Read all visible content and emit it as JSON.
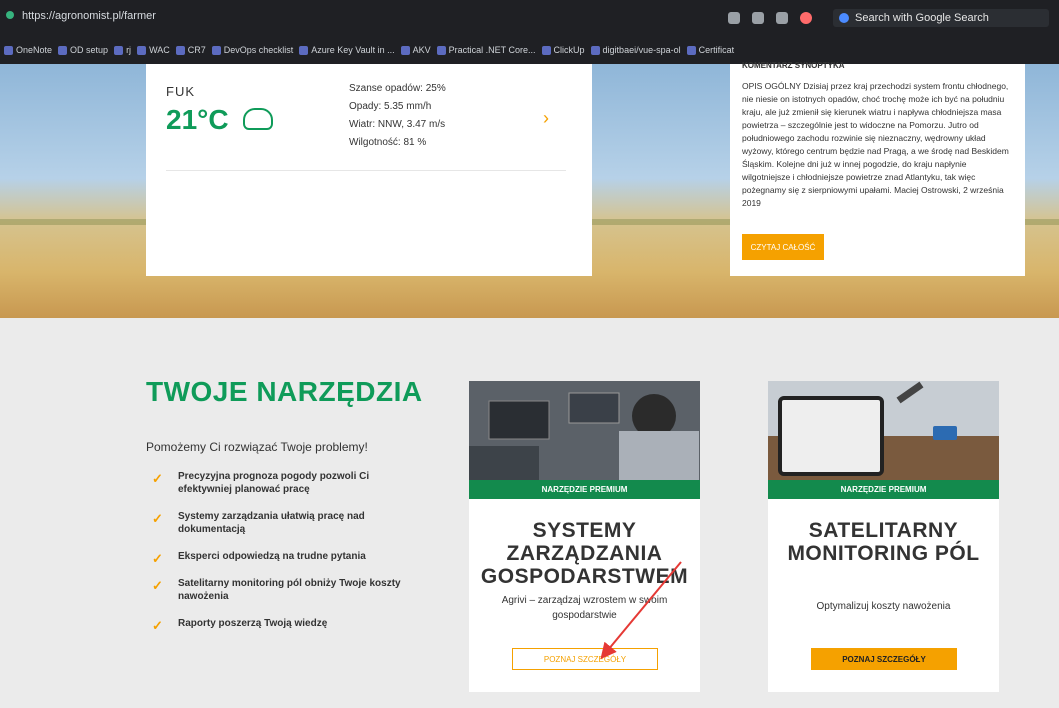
{
  "browser": {
    "url": "https://agronomist.pl/farmer",
    "google_search_placeholder": "Search with Google Search",
    "bookmarks": [
      "OneNote",
      "OD setup",
      "rj",
      "WAC",
      "CR7",
      "DevOps checklist",
      "Azure Key Vault in ...",
      "AKV",
      "Practical .NET Core...",
      "ClickUp",
      "digitbaei/vue-spa-ol",
      "Certificat"
    ]
  },
  "weather": {
    "city": "FUK",
    "temperature": "21°C",
    "details": [
      "Szanse opadów: 25%",
      "Opady: 5.35 mm/h",
      "Wiatr: NNW, 3.47 m/s",
      "Wilgotność: 81 %"
    ],
    "next_icon": "chevron-right-icon"
  },
  "description": {
    "heading": "KOMENTARZ SYNOPTYKA",
    "text": "OPIS OGÓLNY Dzisiaj przez kraj przechodzi system frontu chłodnego, nie niesie on istotnych opadów, choć trochę może ich być na południu kraju, ale już zmienił się kierunek wiatru i napływa chłodniejsza masa powietrza – szczególnie jest to widoczne na Pomorzu. Jutro od południowego zachodu rozwinie się nieznaczny, wędrowny układ wyżowy, którego centrum będzie nad Pragą, a we środę nad Beskidem Śląskim. Kolejne dni już w innej pogodzie, do kraju napłynie wilgotniejsze i chłodniejsze powietrze znad Atlantyku, tak więc pożegnamy się z sierpniowymi upałami. Maciej Ostrowski, 2 września 2019",
    "button": "CZYTAJ CAŁOŚĆ"
  },
  "tools": {
    "title": "TWOJE NARZĘDZIA",
    "subtitle": "Pomożemy Ci rozwiązać Twoje problemy!",
    "items": [
      "Precyzyjna prognoza pogody pozwoli Ci efektywniej planować pracę",
      "Systemy zarządzania ułatwią pracę nad dokumentacją",
      "Eksperci odpowiedzą na trudne pytania",
      "Satelitarny monitoring pól obniży Twoje koszty nawożenia",
      "Raporty poszerzą Twoją wiedzę"
    ]
  },
  "cards": [
    {
      "badge": "NARZĘDZIE PREMIUM",
      "title": "SYSTEMY ZARZĄDZANIA GOSPODARSTWEM",
      "description": "Agrivi – zarządzaj wzrostem w swoim gospodarstwie",
      "button": "POZNAJ SZCZEGÓŁY"
    },
    {
      "badge": "NARZĘDZIE PREMIUM",
      "title": "SATELITARNY MONITORING PÓL",
      "description": "Optymalizuj koszty nawożenia",
      "button": "POZNAJ SZCZEGÓŁY"
    }
  ],
  "colors": {
    "accent_green": "#0f9b59",
    "accent_orange": "#f5a100",
    "annotation_red": "#e53935"
  }
}
